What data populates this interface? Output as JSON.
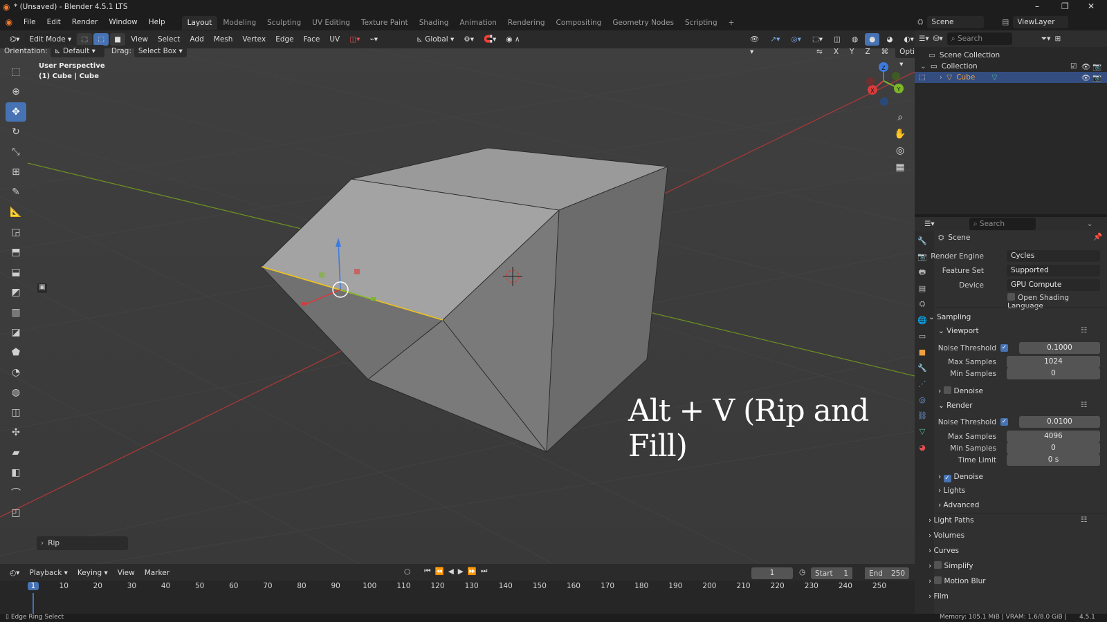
{
  "window": {
    "title": "* (Unsaved) - Blender 4.5.1 LTS"
  },
  "menu": {
    "items": [
      "File",
      "Edit",
      "Render",
      "Window",
      "Help"
    ]
  },
  "workspaces": {
    "tabs": [
      "Layout",
      "Modeling",
      "Sculpting",
      "UV Editing",
      "Texture Paint",
      "Shading",
      "Animation",
      "Rendering",
      "Compositing",
      "Geometry Nodes",
      "Scripting"
    ],
    "active": "Layout",
    "add": "+"
  },
  "topright": {
    "scene": "Scene",
    "view_layer": "ViewLayer"
  },
  "viewport_header": {
    "mode": "Edit Mode",
    "menus": [
      "View",
      "Select",
      "Add",
      "Mesh",
      "Vertex",
      "Edge",
      "Face",
      "UV"
    ],
    "transform_orientation": "Global"
  },
  "tool_settings": {
    "orientation_label": "Orientation:",
    "orientation": "Default",
    "drag_label": "Drag:",
    "drag": "Select Box",
    "axes": [
      "X",
      "Y",
      "Z"
    ],
    "options": "Options"
  },
  "viewport": {
    "perspective": "User Perspective",
    "object_info": "(1) Cube | Cube",
    "overlay_text": "Alt + V (Rip and Fill)",
    "last_op": "Rip",
    "gizmo_axes": {
      "z": "Z",
      "y": "Y",
      "x": "X"
    }
  },
  "outliner": {
    "search_placeholder": "Search",
    "scene_collection": "Scene Collection",
    "collection": "Collection",
    "object": "Cube"
  },
  "properties": {
    "search_placeholder": "Search",
    "context": "Scene",
    "render_engine_label": "Render Engine",
    "render_engine": "Cycles",
    "feature_set_label": "Feature Set",
    "feature_set": "Supported",
    "device_label": "Device",
    "device": "GPU Compute",
    "osl": "Open Shading Language",
    "sampling": "Sampling",
    "viewport_sec": "Viewport",
    "noise_threshold_label": "Noise Threshold",
    "vp_noise_threshold": "0.1000",
    "max_samples_label": "Max Samples",
    "vp_max_samples": "1024",
    "min_samples_label": "Min Samples",
    "vp_min_samples": "0",
    "denoise": "Denoise",
    "render_sec": "Render",
    "r_noise_threshold": "0.0100",
    "r_max_samples": "4096",
    "r_min_samples": "0",
    "time_limit_label": "Time Limit",
    "r_time_limit": "0 s",
    "lights": "Lights",
    "advanced": "Advanced",
    "light_paths": "Light Paths",
    "volumes": "Volumes",
    "curves": "Curves",
    "simplify": "Simplify",
    "motion_blur": "Motion Blur",
    "film": "Film"
  },
  "timeline": {
    "menus": [
      "Playback",
      "Keying",
      "View",
      "Marker"
    ],
    "current_frame": "1",
    "start_label": "Start",
    "start": "1",
    "end_label": "End",
    "end": "250",
    "ticks": [
      "1",
      "10",
      "20",
      "30",
      "40",
      "50",
      "60",
      "70",
      "80",
      "90",
      "100",
      "110",
      "120",
      "130",
      "140",
      "150",
      "160",
      "170",
      "180",
      "190",
      "200",
      "210",
      "220",
      "230",
      "240",
      "250"
    ]
  },
  "status": {
    "left": "Edge Ring Select",
    "right": "Memory: 105.1 MiB | VRAM: 1.6/8.0 GiB |",
    "version": "4.5.1"
  },
  "colors": {
    "accent": "#4772b3",
    "selected_edge": "#f0c419",
    "x_axis": "#d83c3c",
    "y_axis": "#7cb728",
    "z_axis": "#3d7be0"
  }
}
